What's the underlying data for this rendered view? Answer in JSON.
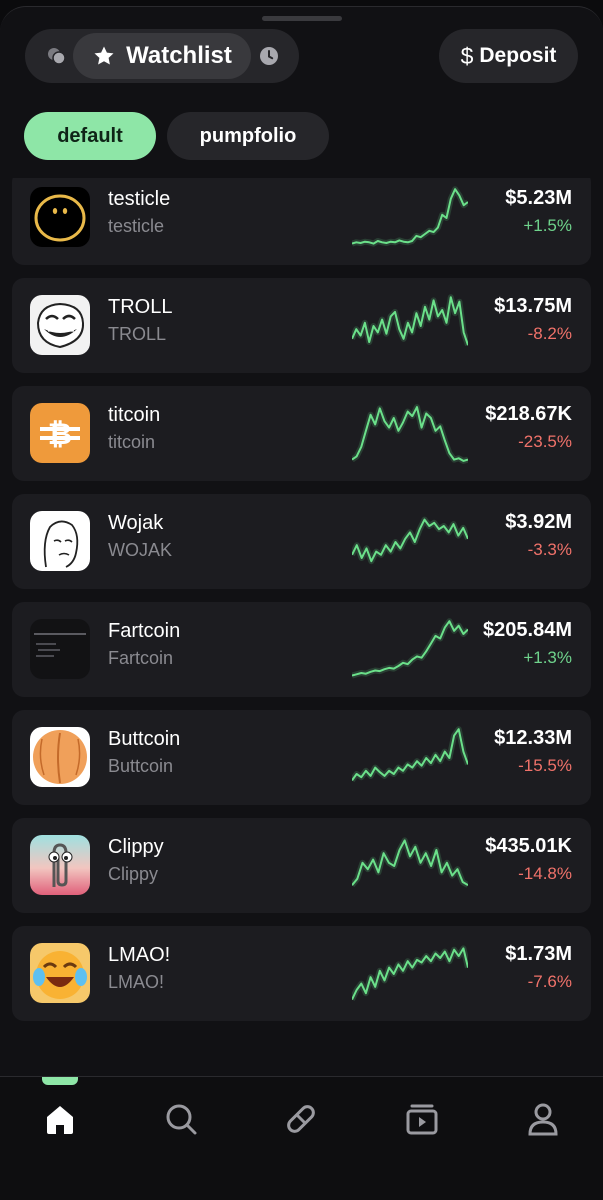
{
  "header": {
    "watchlist_label": "Watchlist",
    "deposit_label": "Deposit",
    "deposit_symbol": "$",
    "icons": [
      "coins-icon",
      "star-icon",
      "clock-icon",
      "dollar-icon"
    ]
  },
  "filters": [
    {
      "label": "default",
      "active": true
    },
    {
      "label": "pumpfolio",
      "active": false
    }
  ],
  "tokens": [
    {
      "name": "testicle",
      "ticker": "testicle",
      "price": "$5.23M",
      "change": "+1.5%",
      "direction": "up",
      "spark": [
        0.1,
        0.12,
        0.11,
        0.13,
        0.12,
        0.1,
        0.14,
        0.12,
        0.11,
        0.13,
        0.12,
        0.15,
        0.13,
        0.12,
        0.14,
        0.22,
        0.2,
        0.25,
        0.3,
        0.28,
        0.35,
        0.55,
        0.5,
        0.8,
        0.95,
        0.85,
        0.7,
        0.75
      ]
    },
    {
      "name": "TROLL",
      "ticker": "TROLL",
      "price": "$13.75M",
      "change": "-8.2%",
      "direction": "down",
      "spark": [
        0.3,
        0.45,
        0.35,
        0.55,
        0.25,
        0.5,
        0.4,
        0.6,
        0.38,
        0.65,
        0.72,
        0.45,
        0.3,
        0.55,
        0.4,
        0.7,
        0.5,
        0.8,
        0.6,
        0.9,
        0.65,
        0.75,
        0.55,
        0.95,
        0.7,
        0.88,
        0.4,
        0.2
      ]
    },
    {
      "name": "titcoin",
      "ticker": "titcoin",
      "price": "$218.67K",
      "change": "-23.5%",
      "direction": "down",
      "spark": [
        0.1,
        0.15,
        0.3,
        0.55,
        0.8,
        0.65,
        0.9,
        0.7,
        0.6,
        0.75,
        0.55,
        0.68,
        0.85,
        0.78,
        0.92,
        0.6,
        0.82,
        0.75,
        0.55,
        0.62,
        0.4,
        0.2,
        0.1,
        0.12,
        0.08,
        0.1
      ]
    },
    {
      "name": "Wojak",
      "ticker": "WOJAK",
      "price": "$3.92M",
      "change": "-3.3%",
      "direction": "down",
      "spark": [
        0.3,
        0.45,
        0.25,
        0.4,
        0.2,
        0.35,
        0.3,
        0.45,
        0.35,
        0.5,
        0.4,
        0.55,
        0.65,
        0.5,
        0.7,
        0.85,
        0.75,
        0.8,
        0.7,
        0.75,
        0.65,
        0.78,
        0.6,
        0.72,
        0.55
      ]
    },
    {
      "name": "Fartcoin",
      "ticker": "Fartcoin",
      "price": "$205.84M",
      "change": "+1.3%",
      "direction": "up",
      "spark": [
        0.1,
        0.12,
        0.14,
        0.13,
        0.16,
        0.18,
        0.17,
        0.2,
        0.22,
        0.21,
        0.25,
        0.3,
        0.28,
        0.35,
        0.4,
        0.38,
        0.48,
        0.6,
        0.72,
        0.68,
        0.85,
        0.95,
        0.8,
        0.88,
        0.75,
        0.82
      ]
    },
    {
      "name": "Buttcoin",
      "ticker": "Buttcoin",
      "price": "$12.33M",
      "change": "-15.5%",
      "direction": "down",
      "spark": [
        0.15,
        0.25,
        0.2,
        0.3,
        0.22,
        0.35,
        0.28,
        0.22,
        0.3,
        0.25,
        0.35,
        0.3,
        0.4,
        0.35,
        0.45,
        0.38,
        0.5,
        0.42,
        0.55,
        0.45,
        0.6,
        0.5,
        0.85,
        0.95,
        0.6,
        0.4
      ]
    },
    {
      "name": "Clippy",
      "ticker": "Clippy",
      "price": "$435.01K",
      "change": "-14.8%",
      "direction": "down",
      "spark": [
        0.2,
        0.3,
        0.55,
        0.45,
        0.6,
        0.4,
        0.7,
        0.55,
        0.5,
        0.75,
        0.9,
        0.65,
        0.8,
        0.55,
        0.7,
        0.5,
        0.75,
        0.4,
        0.55,
        0.35,
        0.45,
        0.25,
        0.2
      ]
    },
    {
      "name": "LMAO!",
      "ticker": "LMAO!",
      "price": "$1.73M",
      "change": "-7.6%",
      "direction": "down",
      "spark": [
        0.1,
        0.25,
        0.35,
        0.2,
        0.45,
        0.3,
        0.55,
        0.4,
        0.6,
        0.5,
        0.65,
        0.55,
        0.7,
        0.6,
        0.72,
        0.68,
        0.78,
        0.7,
        0.82,
        0.75,
        0.85,
        0.7,
        0.88,
        0.78,
        0.9,
        0.6
      ]
    }
  ],
  "tabs": [
    {
      "name": "home-icon",
      "active": true
    },
    {
      "name": "search-icon",
      "active": false
    },
    {
      "name": "pill-icon",
      "active": false
    },
    {
      "name": "video-icon",
      "active": false
    },
    {
      "name": "profile-icon",
      "active": false
    }
  ],
  "colors": {
    "accent": "#8ee6a7",
    "up": "#6fd38c",
    "down": "#f0726a",
    "spark": "#6be08a"
  }
}
